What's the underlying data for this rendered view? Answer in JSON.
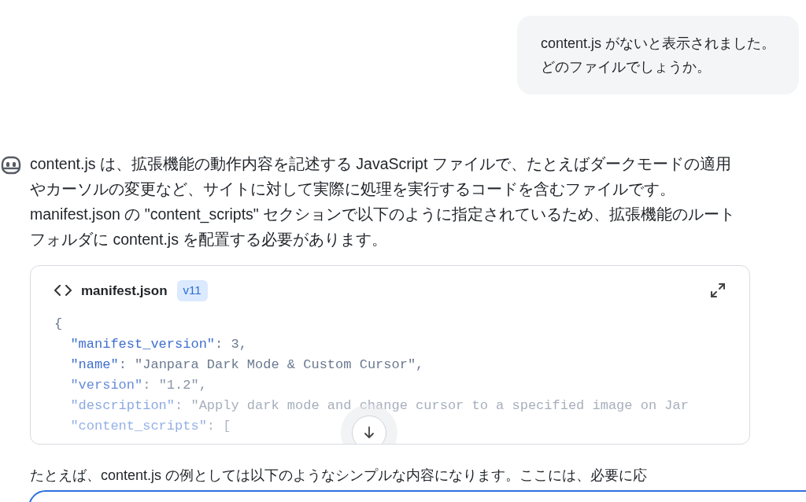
{
  "user_message": {
    "lines": [
      "content.js がないと表示されました。",
      "どのファイルでしょうか。"
    ]
  },
  "assistant_message": {
    "paragraph": "content.js は、拡張機能の動作内容を記述する JavaScript ファイルで、たとえばダークモードの適用やカーソルの変更など、サイトに対して実際に処理を実行するコードを含むファイルです。manifest.json の \"content_scripts\" セクションで以下のように指定されているため、拡張機能のルートフォルダに content.js を配置する必要があります。",
    "code_block": {
      "filename": "manifest.json",
      "version": "v11",
      "lines": [
        {
          "value": "{"
        },
        {
          "key": "\"manifest_version\"",
          "value": ": 3,"
        },
        {
          "key": "\"name\"",
          "value": ": \"Janpara Dark Mode & Custom Cursor\","
        },
        {
          "key": "\"version\"",
          "value": ": \"1.2\","
        },
        {
          "key": "\"description\"",
          "value": ": \"Apply dark mode and change cursor to a specified image on Jar"
        },
        {
          "key": "\"content_scripts\"",
          "value": ": ["
        }
      ]
    },
    "next_paragraph": "たとえば、content.js の例としては以下のようなシンプルな内容になります。ここには、必要に応"
  }
}
